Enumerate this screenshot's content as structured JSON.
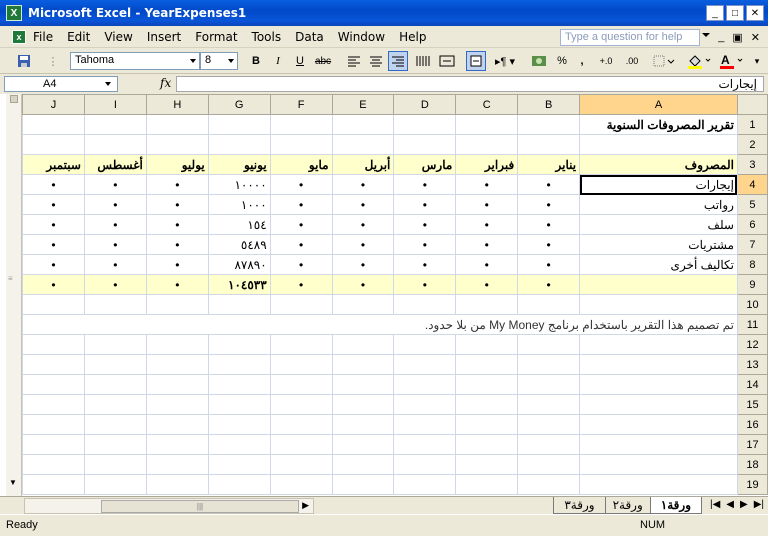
{
  "window": {
    "title": "Microsoft Excel - YearExpenses1",
    "app_icon_label": "X"
  },
  "menu": {
    "items": [
      {
        "label": "File"
      },
      {
        "label": "Edit"
      },
      {
        "label": "View"
      },
      {
        "label": "Insert"
      },
      {
        "label": "Format"
      },
      {
        "label": "Tools"
      },
      {
        "label": "Data"
      },
      {
        "label": "Window"
      },
      {
        "label": "Help"
      }
    ],
    "ask_placeholder": "Type a question for help"
  },
  "toolbar": {
    "font": "Tahoma",
    "size": "8",
    "bold": "B",
    "italic": "I",
    "underline": "U",
    "strike": "abc",
    "percent": "%",
    "comma": ",",
    "inc_decimal": "+.0",
    "dec_decimal": ".00"
  },
  "formula": {
    "name_box": "A4",
    "fx": "fx",
    "content": "إيجارات"
  },
  "sheet": {
    "columns": [
      "J",
      "I",
      "H",
      "G",
      "F",
      "E",
      "D",
      "C",
      "B",
      "A"
    ],
    "rows": [
      "1",
      "2",
      "3",
      "4",
      "5",
      "6",
      "7",
      "8",
      "9",
      "10",
      "11",
      "12",
      "13",
      "14",
      "15",
      "16",
      "17",
      "18",
      "19"
    ],
    "title": "تقرير المصروفات السنوية",
    "header": {
      "expense": "المصروف",
      "months": [
        "سبتمبر",
        "أغسطس",
        "يوليو",
        "يونيو",
        "مايو",
        "أبريل",
        "مارس",
        "فبراير",
        "يناير"
      ]
    },
    "data_rows": [
      {
        "label": "إيجارات",
        "values": [
          "•",
          "•",
          "•",
          "١٠٠٠٠",
          "•",
          "•",
          "•",
          "•",
          "•"
        ]
      },
      {
        "label": "رواتب",
        "values": [
          "•",
          "•",
          "•",
          "١٠٠٠",
          "•",
          "•",
          "•",
          "•",
          "•"
        ]
      },
      {
        "label": "سلف",
        "values": [
          "•",
          "•",
          "•",
          "١٥٤",
          "•",
          "•",
          "•",
          "•",
          "•"
        ]
      },
      {
        "label": "مشتريات",
        "values": [
          "•",
          "•",
          "•",
          "٥٤٨٩",
          "•",
          "•",
          "•",
          "•",
          "•"
        ]
      },
      {
        "label": "تكاليف أخرى",
        "values": [
          "•",
          "•",
          "•",
          "٨٧٨٩٠",
          "•",
          "•",
          "•",
          "•",
          "•"
        ]
      }
    ],
    "total_row": {
      "values": [
        "•",
        "•",
        "•",
        "١٠٤٥٣٣",
        "•",
        "•",
        "•",
        "•",
        "•"
      ]
    },
    "note": "تم تصميم هذا التقرير باستخدام برنامج My Money من بلا حدود."
  },
  "tabs": {
    "sheets": [
      "ورقة١",
      "ورقة٢",
      "ورقة٣"
    ],
    "active": "ورقة١"
  },
  "status": {
    "ready": "Ready",
    "num": "NUM"
  }
}
